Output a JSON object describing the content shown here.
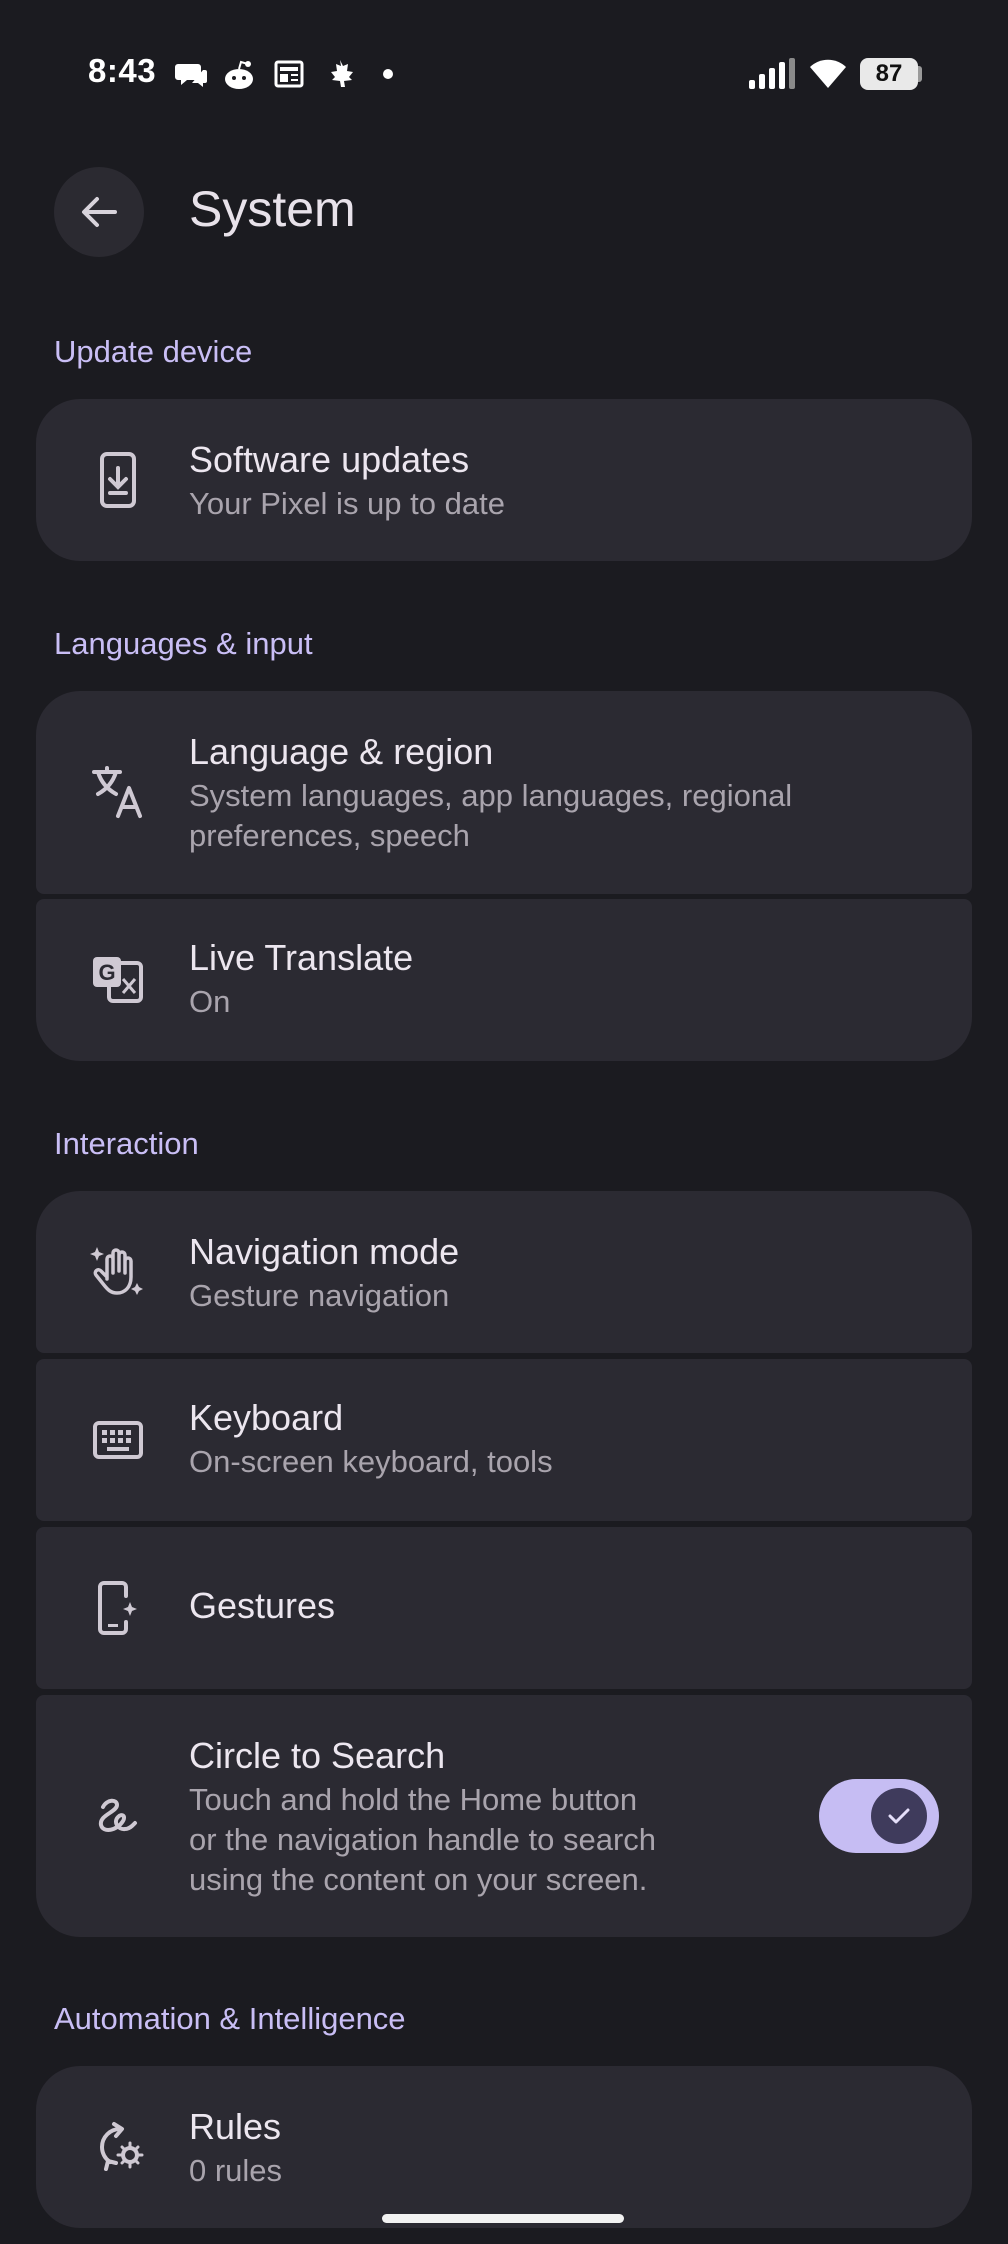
{
  "status_bar": {
    "time": "8:43",
    "battery_level": "87",
    "notification_icons": [
      "chat-icon",
      "reddit-icon",
      "news-icon",
      "maple-leaf-icon",
      "dot-icon"
    ]
  },
  "header": {
    "title": "System"
  },
  "sections": {
    "update_device": "Update device",
    "languages_input": "Languages & input",
    "interaction": "Interaction",
    "automation": "Automation & Intelligence"
  },
  "items": {
    "software_updates": {
      "title": "Software updates",
      "subtitle": "Your Pixel is up to date"
    },
    "language_region": {
      "title": "Language & region",
      "subtitle_line1": "System languages, app languages, regional",
      "subtitle_line2": "preferences, speech"
    },
    "live_translate": {
      "title": "Live Translate",
      "subtitle": "On"
    },
    "navigation_mode": {
      "title": "Navigation mode",
      "subtitle": "Gesture navigation"
    },
    "keyboard": {
      "title": "Keyboard",
      "subtitle": "On-screen keyboard, tools"
    },
    "gestures": {
      "title": "Gestures"
    },
    "circle_to_search": {
      "title": "Circle to Search",
      "subtitle_line1": "Touch and hold the Home button",
      "subtitle_line2": "or the navigation handle to search",
      "subtitle_line3": "using the content on your screen.",
      "enabled": true
    },
    "rules": {
      "title": "Rules",
      "subtitle": "0 rules"
    }
  },
  "colors": {
    "background": "#1b1b20",
    "card": "#2b2a32",
    "accent": "#c9bef5",
    "toggle_track": "#c6bdf3"
  }
}
